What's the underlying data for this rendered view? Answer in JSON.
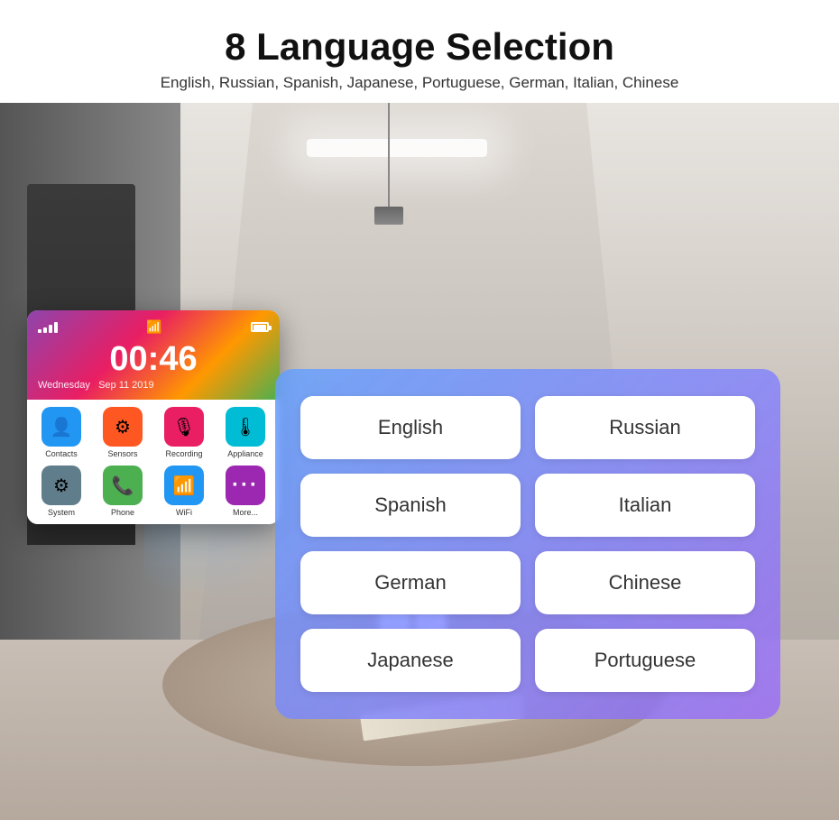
{
  "header": {
    "title": "8 Language Selection",
    "subtitle": "English, Russian, Spanish, Japanese, Portuguese, German, Italian, Chinese"
  },
  "device": {
    "time": "00:46",
    "day": "Wednesday",
    "date": "Sep 11 2019",
    "apps": [
      {
        "label": "Contacts",
        "color": "#2196F3",
        "icon": "👤"
      },
      {
        "label": "Sensors",
        "color": "#FF5722",
        "icon": "⚙"
      },
      {
        "label": "Recording",
        "color": "#E91E63",
        "icon": "🎙"
      },
      {
        "label": "Appliance",
        "color": "#00BCD4",
        "icon": "🌡"
      },
      {
        "label": "System",
        "color": "#607D8B",
        "icon": "⚙"
      },
      {
        "label": "Phone",
        "color": "#4CAF50",
        "icon": "📞"
      },
      {
        "label": "WiFi",
        "color": "#2196F3",
        "icon": "📶"
      },
      {
        "label": "More...",
        "color": "#9C27B0",
        "icon": "···"
      }
    ]
  },
  "languages": {
    "buttons": [
      {
        "label": "English",
        "row": 0,
        "col": 0
      },
      {
        "label": "Russian",
        "row": 0,
        "col": 1
      },
      {
        "label": "Spanish",
        "row": 1,
        "col": 0
      },
      {
        "label": "Italian",
        "row": 1,
        "col": 1
      },
      {
        "label": "German",
        "row": 2,
        "col": 0
      },
      {
        "label": "Chinese",
        "row": 2,
        "col": 1
      },
      {
        "label": "Japanese",
        "row": 3,
        "col": 0
      },
      {
        "label": "Portuguese",
        "row": 3,
        "col": 1
      }
    ]
  }
}
